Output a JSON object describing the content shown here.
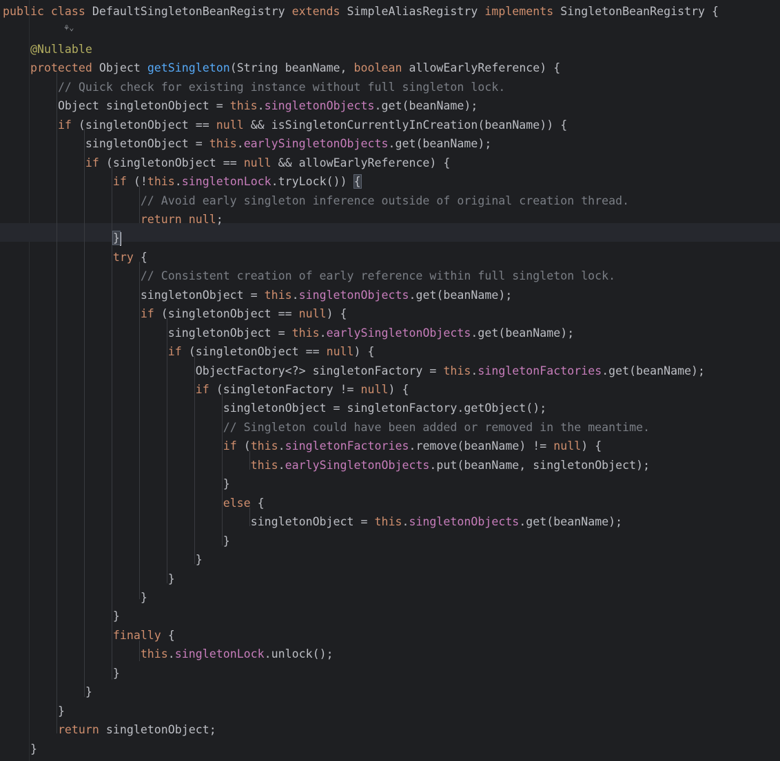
{
  "editor": {
    "inlay_hint": {
      "icon": "ai-assistant-icon",
      "glyph": "⚘",
      "chevron": "⌄"
    },
    "lines": [
      {
        "id": "l0",
        "indent": "",
        "parts": [
          [
            "k",
            "public class "
          ],
          [
            "t",
            "DefaultSingletonBeanRegistry "
          ],
          [
            "k",
            "extends "
          ],
          [
            "t",
            "SimpleAliasRegistry "
          ],
          [
            "k",
            "implements "
          ],
          [
            "t",
            "SingletonBeanRegistry {"
          ]
        ]
      },
      {
        "id": "l2",
        "indent": "    ",
        "parts": [
          [
            "a",
            "@Nullable"
          ]
        ]
      },
      {
        "id": "l3",
        "indent": "    ",
        "parts": [
          [
            "k",
            "protected "
          ],
          [
            "t",
            "Object "
          ],
          [
            "f",
            "getSingleton"
          ],
          [
            "t",
            "(String beanName, "
          ],
          [
            "k",
            "boolean "
          ],
          [
            "t",
            "allowEarlyReference) {"
          ]
        ]
      },
      {
        "id": "l4",
        "indent": "        ",
        "parts": [
          [
            "c",
            "// Quick check for existing instance without full singleton lock."
          ]
        ]
      },
      {
        "id": "l5",
        "indent": "        ",
        "parts": [
          [
            "t",
            "Object singletonObject = "
          ],
          [
            "k",
            "this"
          ],
          [
            "t",
            "."
          ],
          [
            "m",
            "singletonObjects"
          ],
          [
            "t",
            ".get(beanName);"
          ]
        ]
      },
      {
        "id": "l6",
        "indent": "        ",
        "parts": [
          [
            "k",
            "if "
          ],
          [
            "t",
            "(singletonObject == "
          ],
          [
            "k",
            "null "
          ],
          [
            "t",
            "&& isSingletonCurrentlyInCreation(beanName)) {"
          ]
        ]
      },
      {
        "id": "l7",
        "indent": "            ",
        "parts": [
          [
            "t",
            "singletonObject = "
          ],
          [
            "k",
            "this"
          ],
          [
            "t",
            "."
          ],
          [
            "m",
            "earlySingletonObjects"
          ],
          [
            "t",
            ".get(beanName);"
          ]
        ]
      },
      {
        "id": "l8",
        "indent": "            ",
        "parts": [
          [
            "k",
            "if "
          ],
          [
            "t",
            "(singletonObject == "
          ],
          [
            "k",
            "null "
          ],
          [
            "t",
            "&& allowEarlyReference) {"
          ]
        ]
      },
      {
        "id": "l9",
        "indent": "                ",
        "parts": [
          [
            "k",
            "if "
          ],
          [
            "t",
            "(!"
          ],
          [
            "k",
            "this"
          ],
          [
            "t",
            "."
          ],
          [
            "m",
            "singletonLock"
          ],
          [
            "t",
            ".tryLock()) "
          ],
          [
            "hl",
            "{"
          ]
        ]
      },
      {
        "id": "l10",
        "indent": "                    ",
        "parts": [
          [
            "c",
            "// Avoid early singleton inference outside of original creation thread."
          ]
        ]
      },
      {
        "id": "l11",
        "indent": "                    ",
        "parts": [
          [
            "k",
            "return null"
          ],
          [
            "t",
            ";"
          ]
        ]
      },
      {
        "id": "l12",
        "indent": "                ",
        "parts": [
          [
            "hl",
            "}"
          ],
          [
            "caret",
            ""
          ]
        ]
      },
      {
        "id": "l13",
        "indent": "                ",
        "parts": [
          [
            "k",
            "try "
          ],
          [
            "t",
            "{"
          ]
        ]
      },
      {
        "id": "l14",
        "indent": "                    ",
        "parts": [
          [
            "c",
            "// Consistent creation of early reference within full singleton lock."
          ]
        ]
      },
      {
        "id": "l15",
        "indent": "                    ",
        "parts": [
          [
            "t",
            "singletonObject = "
          ],
          [
            "k",
            "this"
          ],
          [
            "t",
            "."
          ],
          [
            "m",
            "singletonObjects"
          ],
          [
            "t",
            ".get(beanName);"
          ]
        ]
      },
      {
        "id": "l16",
        "indent": "                    ",
        "parts": [
          [
            "k",
            "if "
          ],
          [
            "t",
            "(singletonObject == "
          ],
          [
            "k",
            "null"
          ],
          [
            "t",
            ") {"
          ]
        ]
      },
      {
        "id": "l17",
        "indent": "                        ",
        "parts": [
          [
            "t",
            "singletonObject = "
          ],
          [
            "k",
            "this"
          ],
          [
            "t",
            "."
          ],
          [
            "m",
            "earlySingletonObjects"
          ],
          [
            "t",
            ".get(beanName);"
          ]
        ]
      },
      {
        "id": "l18",
        "indent": "                        ",
        "parts": [
          [
            "k",
            "if "
          ],
          [
            "t",
            "(singletonObject == "
          ],
          [
            "k",
            "null"
          ],
          [
            "t",
            ") {"
          ]
        ]
      },
      {
        "id": "l19",
        "indent": "                            ",
        "parts": [
          [
            "t",
            "ObjectFactory<?> singletonFactory = "
          ],
          [
            "k",
            "this"
          ],
          [
            "t",
            "."
          ],
          [
            "m",
            "singletonFactories"
          ],
          [
            "t",
            ".get(beanName);"
          ]
        ]
      },
      {
        "id": "l20",
        "indent": "                            ",
        "parts": [
          [
            "k",
            "if "
          ],
          [
            "t",
            "(singletonFactory != "
          ],
          [
            "k",
            "null"
          ],
          [
            "t",
            ") {"
          ]
        ]
      },
      {
        "id": "l21",
        "indent": "                                ",
        "parts": [
          [
            "t",
            "singletonObject = singletonFactory.getObject();"
          ]
        ]
      },
      {
        "id": "l22",
        "indent": "                                ",
        "parts": [
          [
            "c",
            "// Singleton could have been added or removed in the meantime."
          ]
        ]
      },
      {
        "id": "l23",
        "indent": "                                ",
        "parts": [
          [
            "k",
            "if "
          ],
          [
            "t",
            "("
          ],
          [
            "k",
            "this"
          ],
          [
            "t",
            "."
          ],
          [
            "m",
            "singletonFactories"
          ],
          [
            "t",
            ".remove(beanName) != "
          ],
          [
            "k",
            "null"
          ],
          [
            "t",
            ") {"
          ]
        ]
      },
      {
        "id": "l24",
        "indent": "                                    ",
        "parts": [
          [
            "k",
            "this"
          ],
          [
            "t",
            "."
          ],
          [
            "m",
            "earlySingletonObjects"
          ],
          [
            "t",
            ".put(beanName, singletonObject);"
          ]
        ]
      },
      {
        "id": "l25",
        "indent": "                                ",
        "parts": [
          [
            "t",
            "}"
          ]
        ]
      },
      {
        "id": "l26",
        "indent": "                                ",
        "parts": [
          [
            "k",
            "else "
          ],
          [
            "t",
            "{"
          ]
        ]
      },
      {
        "id": "l27",
        "indent": "                                    ",
        "parts": [
          [
            "t",
            "singletonObject = "
          ],
          [
            "k",
            "this"
          ],
          [
            "t",
            "."
          ],
          [
            "m",
            "singletonObjects"
          ],
          [
            "t",
            ".get(beanName);"
          ]
        ]
      },
      {
        "id": "l28",
        "indent": "                                ",
        "parts": [
          [
            "t",
            "}"
          ]
        ]
      },
      {
        "id": "l29",
        "indent": "                            ",
        "parts": [
          [
            "t",
            "}"
          ]
        ]
      },
      {
        "id": "l30",
        "indent": "                        ",
        "parts": [
          [
            "t",
            "}"
          ]
        ]
      },
      {
        "id": "l31",
        "indent": "                    ",
        "parts": [
          [
            "t",
            "}"
          ]
        ]
      },
      {
        "id": "l32",
        "indent": "                ",
        "parts": [
          [
            "t",
            "}"
          ]
        ]
      },
      {
        "id": "l33",
        "indent": "                ",
        "parts": [
          [
            "k",
            "finally "
          ],
          [
            "t",
            "{"
          ]
        ]
      },
      {
        "id": "l34",
        "indent": "                    ",
        "parts": [
          [
            "k",
            "this"
          ],
          [
            "t",
            "."
          ],
          [
            "m",
            "singletonLock"
          ],
          [
            "t",
            ".unlock();"
          ]
        ]
      },
      {
        "id": "l35",
        "indent": "                ",
        "parts": [
          [
            "t",
            "}"
          ]
        ]
      },
      {
        "id": "l36",
        "indent": "            ",
        "parts": [
          [
            "t",
            "}"
          ]
        ]
      },
      {
        "id": "l37",
        "indent": "        ",
        "parts": [
          [
            "t",
            "}"
          ]
        ]
      },
      {
        "id": "l38",
        "indent": "        ",
        "parts": [
          [
            "k",
            "return "
          ],
          [
            "t",
            "singletonObject;"
          ]
        ]
      },
      {
        "id": "l39",
        "indent": "    ",
        "parts": [
          [
            "t",
            "}"
          ]
        ]
      }
    ]
  },
  "colors": {
    "background": "#1e1f22",
    "keyword": "#cf8e6d",
    "comment": "#7a7e85",
    "function": "#56a8f5",
    "annotation": "#b3ae60",
    "field": "#c77dbb",
    "text": "#bcbec4"
  }
}
